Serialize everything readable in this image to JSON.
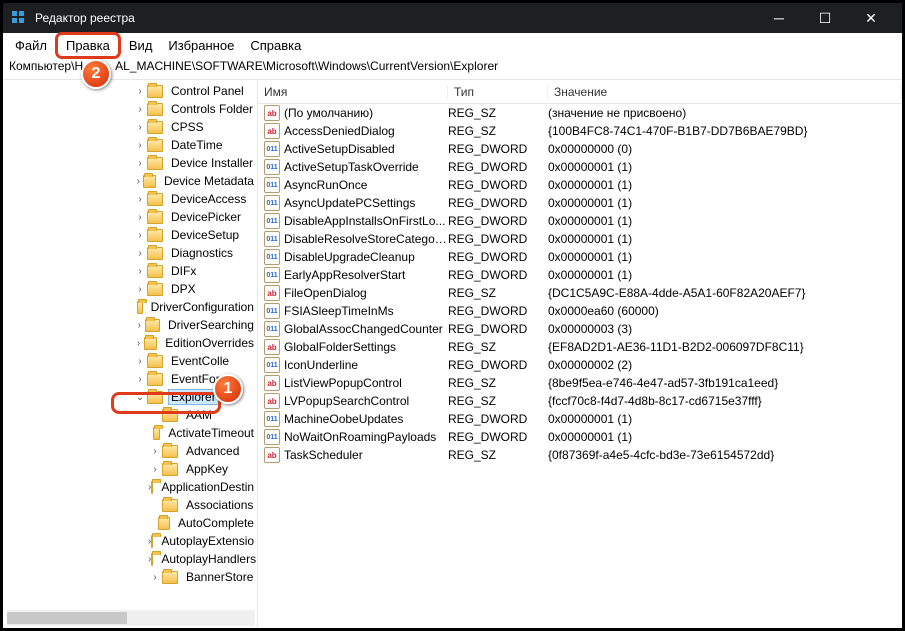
{
  "title": "Редактор реестра",
  "menubar": [
    "Файл",
    "Правка",
    "Вид",
    "Избранное",
    "Справка"
  ],
  "address": "Компьютер\\HKEY_LOCAL_MACHINE\\SOFTWARE\\Microsoft\\Windows\\CurrentVersion\\Explorer",
  "address_display_left": "Компьютер\\H",
  "address_display_right": "AL_MACHINE\\SOFTWARE\\Microsoft\\Windows\\CurrentVersion\\Explorer",
  "tree": {
    "level1": [
      {
        "label": "Control Panel",
        "exp": ">"
      },
      {
        "label": "Controls Folder",
        "exp": ">"
      },
      {
        "label": "CPSS",
        "exp": ">"
      },
      {
        "label": "DateTime",
        "exp": ">"
      },
      {
        "label": "Device Installer",
        "exp": ">"
      },
      {
        "label": "Device Metadata",
        "exp": ">"
      },
      {
        "label": "DeviceAccess",
        "exp": ">"
      },
      {
        "label": "DevicePicker",
        "exp": ">"
      },
      {
        "label": "DeviceSetup",
        "exp": ">"
      },
      {
        "label": "Diagnostics",
        "exp": ">"
      },
      {
        "label": "DIFx",
        "exp": ">"
      },
      {
        "label": "DPX",
        "exp": ">"
      },
      {
        "label": "DriverConfiguration",
        "exp": ""
      },
      {
        "label": "DriverSearching",
        "exp": ">"
      },
      {
        "label": "EditionOverrides",
        "exp": ">"
      },
      {
        "label": "EventColle",
        "exp": ">"
      },
      {
        "label": "EventFor",
        "exp": ">"
      }
    ],
    "selected": {
      "label": "Explorer",
      "exp": "v"
    },
    "children": [
      {
        "label": "AAM",
        "exp": ""
      },
      {
        "label": "ActivateTimeout",
        "exp": ""
      },
      {
        "label": "Advanced",
        "exp": ">"
      },
      {
        "label": "AppKey",
        "exp": ">"
      },
      {
        "label": "ApplicationDestin",
        "exp": ">"
      },
      {
        "label": "Associations",
        "exp": ""
      },
      {
        "label": "AutoComplete",
        "exp": ""
      },
      {
        "label": "AutoplayExtensio",
        "exp": ">"
      },
      {
        "label": "AutoplayHandlers",
        "exp": ">"
      },
      {
        "label": "BannerStore",
        "exp": ">"
      }
    ]
  },
  "columns": {
    "name": "Имя",
    "type": "Тип",
    "value": "Значение"
  },
  "values": [
    {
      "t": "sz",
      "name": "(По умолчанию)",
      "type": "REG_SZ",
      "value": "(значение не присвоено)"
    },
    {
      "t": "sz",
      "name": "AccessDeniedDialog",
      "type": "REG_SZ",
      "value": "{100B4FC8-74C1-470F-B1B7-DD7B6BAE79BD}"
    },
    {
      "t": "dw",
      "name": "ActiveSetupDisabled",
      "type": "REG_DWORD",
      "value": "0x00000000 (0)"
    },
    {
      "t": "dw",
      "name": "ActiveSetupTaskOverride",
      "type": "REG_DWORD",
      "value": "0x00000001 (1)"
    },
    {
      "t": "dw",
      "name": "AsyncRunOnce",
      "type": "REG_DWORD",
      "value": "0x00000001 (1)"
    },
    {
      "t": "dw",
      "name": "AsyncUpdatePCSettings",
      "type": "REG_DWORD",
      "value": "0x00000001 (1)"
    },
    {
      "t": "dw",
      "name": "DisableAppInstallsOnFirstLo...",
      "type": "REG_DWORD",
      "value": "0x00000001 (1)"
    },
    {
      "t": "dw",
      "name": "DisableResolveStoreCategories",
      "type": "REG_DWORD",
      "value": "0x00000001 (1)"
    },
    {
      "t": "dw",
      "name": "DisableUpgradeCleanup",
      "type": "REG_DWORD",
      "value": "0x00000001 (1)"
    },
    {
      "t": "dw",
      "name": "EarlyAppResolverStart",
      "type": "REG_DWORD",
      "value": "0x00000001 (1)"
    },
    {
      "t": "sz",
      "name": "FileOpenDialog",
      "type": "REG_SZ",
      "value": "{DC1C5A9C-E88A-4dde-A5A1-60F82A20AEF7}"
    },
    {
      "t": "dw",
      "name": "FSIASleepTimeInMs",
      "type": "REG_DWORD",
      "value": "0x0000ea60 (60000)"
    },
    {
      "t": "dw",
      "name": "GlobalAssocChangedCounter",
      "type": "REG_DWORD",
      "value": "0x00000003 (3)"
    },
    {
      "t": "sz",
      "name": "GlobalFolderSettings",
      "type": "REG_SZ",
      "value": "{EF8AD2D1-AE36-11D1-B2D2-006097DF8C11}"
    },
    {
      "t": "dw",
      "name": "IconUnderline",
      "type": "REG_DWORD",
      "value": "0x00000002 (2)"
    },
    {
      "t": "sz",
      "name": "ListViewPopupControl",
      "type": "REG_SZ",
      "value": "{8be9f5ea-e746-4e47-ad57-3fb191ca1eed}"
    },
    {
      "t": "sz",
      "name": "LVPopupSearchControl",
      "type": "REG_SZ",
      "value": "{fccf70c8-f4d7-4d8b-8c17-cd6715e37fff}"
    },
    {
      "t": "dw",
      "name": "MachineOobeUpdates",
      "type": "REG_DWORD",
      "value": "0x00000001 (1)"
    },
    {
      "t": "dw",
      "name": "NoWaitOnRoamingPayloads",
      "type": "REG_DWORD",
      "value": "0x00000001 (1)"
    },
    {
      "t": "sz",
      "name": "TaskScheduler",
      "type": "REG_SZ",
      "value": "{0f87369f-a4e5-4cfc-bd3e-73e6154572dd}"
    }
  ],
  "callouts": {
    "one": "1",
    "two": "2"
  }
}
